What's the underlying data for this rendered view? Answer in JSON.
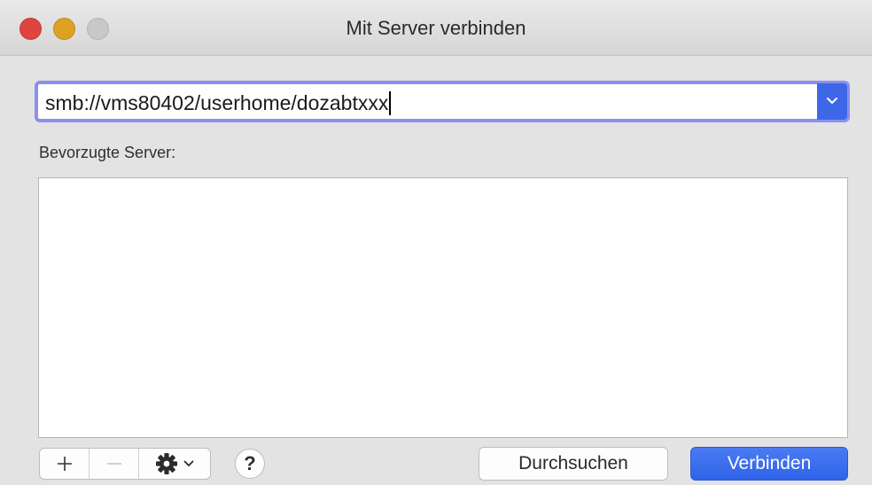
{
  "window": {
    "title": "Mit Server verbinden"
  },
  "address": {
    "value": "smb://vms80402/userhome/dozabtxxx"
  },
  "favorites": {
    "label": "Bevorzugte Server:",
    "items": []
  },
  "toolbar": {
    "add_icon": "plus-icon",
    "remove_icon": "minus-icon",
    "action_icon": "gear-icon",
    "help_label": "?"
  },
  "buttons": {
    "browse_label": "Durchsuchen",
    "connect_label": "Verbinden"
  },
  "colors": {
    "accent": "#3e67e8",
    "focus_ring": "#8b8ff0",
    "close": "#e0443e",
    "minimize": "#dea123",
    "zoom_inactive": "#c8c8c8"
  }
}
